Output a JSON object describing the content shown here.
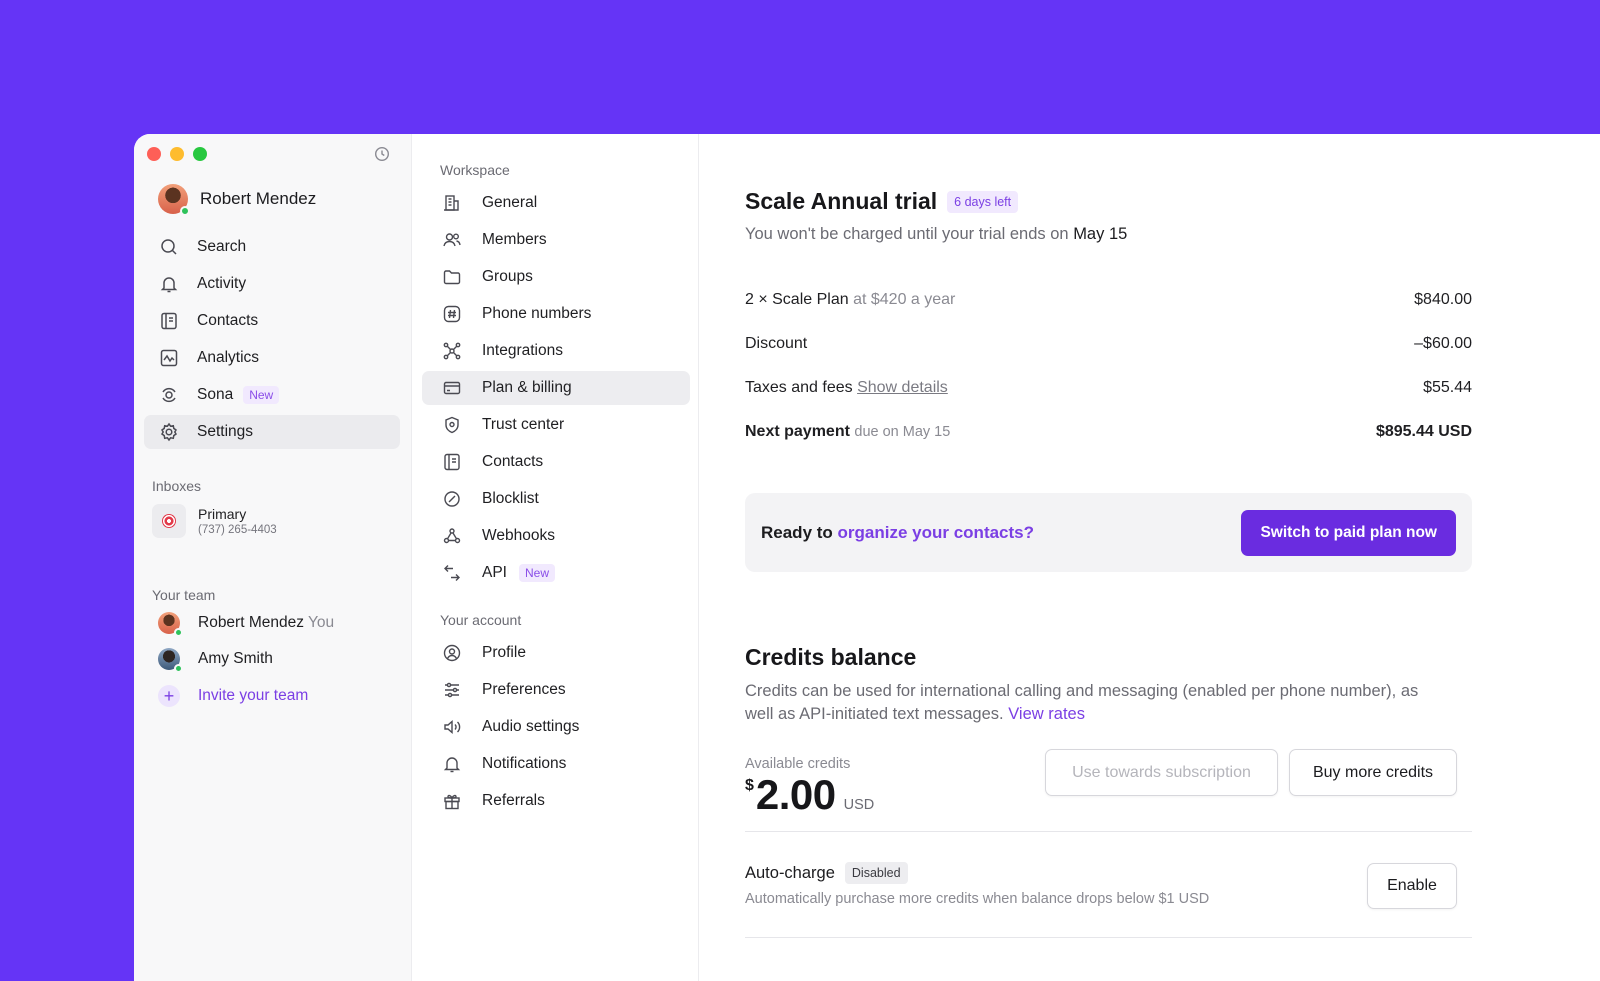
{
  "user": {
    "name": "Robert Mendez"
  },
  "nav": [
    {
      "label": "Search",
      "icon": "search-icon"
    },
    {
      "label": "Activity",
      "icon": "bell-icon"
    },
    {
      "label": "Contacts",
      "icon": "contacts-icon"
    },
    {
      "label": "Analytics",
      "icon": "analytics-icon"
    },
    {
      "label": "Sona",
      "icon": "sona-icon",
      "badge": "New"
    },
    {
      "label": "Settings",
      "icon": "gear-icon",
      "active": true
    }
  ],
  "inboxes": {
    "label": "Inboxes",
    "items": [
      {
        "name": "Primary",
        "phone": "(737) 265-4403"
      }
    ]
  },
  "team": {
    "label": "Your team",
    "members": [
      {
        "name": "Robert Mendez",
        "suffix": "You"
      },
      {
        "name": "Amy Smith"
      }
    ],
    "invite_label": "Invite your team"
  },
  "settings_nav": {
    "workspace_label": "Workspace",
    "workspace_items": [
      {
        "label": "General",
        "icon": "building-icon"
      },
      {
        "label": "Members",
        "icon": "members-icon"
      },
      {
        "label": "Groups",
        "icon": "folder-icon"
      },
      {
        "label": "Phone numbers",
        "icon": "hash-icon"
      },
      {
        "label": "Integrations",
        "icon": "integrations-icon"
      },
      {
        "label": "Plan & billing",
        "icon": "card-icon",
        "active": true
      },
      {
        "label": "Trust center",
        "icon": "shield-icon"
      },
      {
        "label": "Contacts",
        "icon": "contacts-icon"
      },
      {
        "label": "Blocklist",
        "icon": "block-icon"
      },
      {
        "label": "Webhooks",
        "icon": "webhooks-icon"
      },
      {
        "label": "API",
        "icon": "api-icon",
        "badge": "New"
      }
    ],
    "account_label": "Your account",
    "account_items": [
      {
        "label": "Profile",
        "icon": "profile-icon"
      },
      {
        "label": "Preferences",
        "icon": "sliders-icon"
      },
      {
        "label": "Audio settings",
        "icon": "speaker-icon"
      },
      {
        "label": "Notifications",
        "icon": "bell-icon"
      },
      {
        "label": "Referrals",
        "icon": "gift-icon"
      }
    ]
  },
  "plan": {
    "title": "Scale Annual trial",
    "days_left": "6 days left",
    "subtitle_prefix": "You won't be charged until your trial ends on",
    "subtitle_date": "May 15",
    "lines": [
      {
        "label": "2 × Scale Plan",
        "detail": "at $420 a year",
        "amount": "$840.00"
      },
      {
        "label": "Discount",
        "amount": "–$60.00"
      },
      {
        "label": "Taxes and fees",
        "link": "Show details",
        "amount": "$55.44"
      }
    ],
    "next_payment": {
      "label": "Next payment",
      "detail": "due on May 15",
      "amount": "$895.44 USD"
    },
    "cta": {
      "prefix": "Ready to",
      "accent": "organize your contacts?",
      "button": "Switch to paid plan now"
    }
  },
  "credits": {
    "title": "Credits balance",
    "description": "Credits can be used for international calling and messaging (enabled per phone number), as well as API-initiated text messages.",
    "view_rates": "View rates",
    "available_label": "Available credits",
    "currency_symbol": "$",
    "amount": "2.00",
    "unit": "USD",
    "use_button": "Use towards subscription",
    "buy_button": "Buy more credits",
    "auto_charge": {
      "title": "Auto-charge",
      "status": "Disabled",
      "description": "Automatically purchase more credits when balance drops below $1 USD",
      "button": "Enable"
    }
  },
  "colors": {
    "background": "#6534f6",
    "accent": "#7b3fe4",
    "primary_button": "#6a2ce0"
  }
}
